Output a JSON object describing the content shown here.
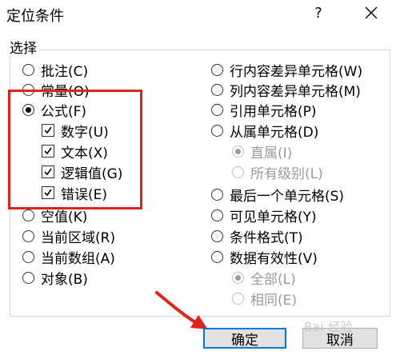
{
  "dialog": {
    "title": "定位条件",
    "help": "?",
    "group_label": "选择"
  },
  "left_options": [
    {
      "label": "批注(C)",
      "checked": false
    },
    {
      "label": "常量(O)",
      "checked": false
    },
    {
      "label": "公式(F)",
      "checked": true
    },
    {
      "label": "空值(K)",
      "checked": false
    },
    {
      "label": "当前区域(R)",
      "checked": false
    },
    {
      "label": "当前数组(A)",
      "checked": false
    },
    {
      "label": "对象(B)",
      "checked": false
    }
  ],
  "formula_checks": [
    {
      "label": "数字(U)",
      "checked": true
    },
    {
      "label": "文本(X)",
      "checked": true
    },
    {
      "label": "逻辑值(G)",
      "checked": true
    },
    {
      "label": "错误(E)",
      "checked": true
    }
  ],
  "right_options": [
    {
      "label": "行内容差异单元格(W)",
      "checked": false
    },
    {
      "label": "列内容差异单元格(M)",
      "checked": false
    },
    {
      "label": "引用单元格(P)",
      "checked": false
    },
    {
      "label": "从属单元格(D)",
      "checked": false
    },
    {
      "label": "最后一个单元格(S)",
      "checked": false
    },
    {
      "label": "可见单元格(Y)",
      "checked": false
    },
    {
      "label": "条件格式(T)",
      "checked": false
    },
    {
      "label": "数据有效性(V)",
      "checked": false
    }
  ],
  "dependents_sub": [
    {
      "label": "直属(I)",
      "checked": true
    },
    {
      "label": "所有级别(L)",
      "checked": false
    }
  ],
  "validation_sub": [
    {
      "label": "全部(L)",
      "checked": true
    },
    {
      "label": "相同(E)",
      "checked": false
    }
  ],
  "buttons": {
    "ok": "确定",
    "cancel": "取消"
  },
  "watermark": "Bai 经验",
  "colors": {
    "highlight": "#e2231a",
    "ok_border": "#0078d7"
  }
}
